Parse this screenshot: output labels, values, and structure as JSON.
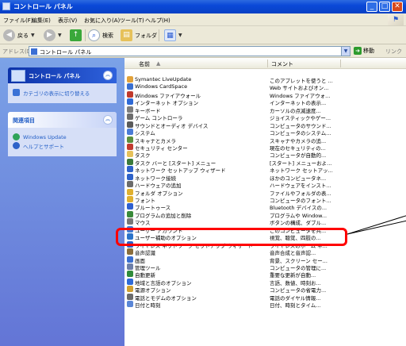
{
  "window": {
    "title": "コントロール パネル"
  },
  "menu": [
    "ファイル(F)",
    "編集(E)",
    "表示(V)",
    "お気に入り(A)",
    "ツール(T)",
    "ヘルプ(H)"
  ],
  "toolbar": {
    "back": "戻る",
    "search": "検索",
    "folders": "フォルダ"
  },
  "address": {
    "label": "アドレス(D)",
    "value": "コントロール パネル",
    "go": "移動",
    "links": "リンク"
  },
  "sidebar": {
    "panel_title": "コントロール パネル",
    "switch_view": "カテゴリの表示に切り替える",
    "related_title": "関連項目",
    "related_links": [
      "Windows Update",
      "ヘルプとサポート"
    ]
  },
  "columns": {
    "name": "名前",
    "comment": "コメント"
  },
  "items": [
    {
      "name": "Symantec LiveUpdate",
      "comment": "このアプレットを使うと ...",
      "color": "#e2a23a"
    },
    {
      "name": "Windows CardSpace",
      "comment": "Web サイトおよびオン...",
      "color": "#3a6fd0"
    },
    {
      "name": "Windows ファイアウォール",
      "comment": "Windows ファイアウォ...",
      "color": "#c0392b"
    },
    {
      "name": "インターネット オプション",
      "comment": "インターネットの表示...",
      "color": "#2f6ad6"
    },
    {
      "name": "キーボード",
      "comment": "カーソルの点滅速度...",
      "color": "#7d7d7d"
    },
    {
      "name": "ゲーム コントローラ",
      "comment": "ジョイスティックやゲー...",
      "color": "#6d6d6d"
    },
    {
      "name": "サウンドとオーディオ デバイス",
      "comment": "コンピュータのサウンド...",
      "color": "#5a5a5a"
    },
    {
      "name": "システム",
      "comment": "コンピュータのシステム...",
      "color": "#4a7bd6"
    },
    {
      "name": "スキャナとカメラ",
      "comment": "スキャナやカメラの追...",
      "color": "#5b8f3c"
    },
    {
      "name": "セキュリティ センター",
      "comment": "現在のセキュリティの...",
      "color": "#c23b2f"
    },
    {
      "name": "タスク",
      "comment": "コンピュータが自動的...",
      "color": "#e6c15a"
    },
    {
      "name": "タスク バーと [スタート] メニュー",
      "comment": "[スタート] メニューおよ...",
      "color": "#3b7a3b"
    },
    {
      "name": "ネットワーク セットアップ ウィザード",
      "comment": "ネットワーク セットアッ...",
      "color": "#2e62c9"
    },
    {
      "name": "ネットワーク接続",
      "comment": "ほかのコンピュータネ...",
      "color": "#2e62c9"
    },
    {
      "name": "ハードウェアの追加",
      "comment": "ハードウェアをインスト...",
      "color": "#6b6b6b"
    },
    {
      "name": "フォルダ オプション",
      "comment": "ファイルやフォルダの表...",
      "color": "#e0b030"
    },
    {
      "name": "フォント",
      "comment": "コンピュータのフォント...",
      "color": "#e0b030"
    },
    {
      "name": "ブルートゥース",
      "comment": "Bluetooth デバイスの...",
      "color": "#2f5fcf"
    },
    {
      "name": "プログラムの追加と削除",
      "comment": "プログラムや Window...",
      "color": "#3a8a3a"
    },
    {
      "name": "マウス",
      "comment": "ボタンの構成、ダブル...",
      "color": "#777777"
    },
    {
      "name": "ユーザー アカウント",
      "comment": "このコンピュータを共...",
      "color": "#3f7bd6"
    },
    {
      "name": "ユーザー補助のオプション",
      "comment": "視覚、聴覚、四肢の...",
      "color": "#2b73c9"
    },
    {
      "name": "ワイヤレス ネットワーク セットアップ ウィザード",
      "comment": "ワイヤレスのホーム ネ...",
      "color": "#2e62c9"
    },
    {
      "name": "音声認識",
      "comment": "音声合成と音声認...",
      "color": "#8a6d3b"
    },
    {
      "name": "画面",
      "comment": "背景、スクリーン セー...",
      "color": "#3a6fd0"
    },
    {
      "name": "管理ツール",
      "comment": "コンピュータの管理に...",
      "color": "#6d7fa8"
    },
    {
      "name": "自動更新",
      "comment": "重要な更新が自動...",
      "color": "#2f8b3a"
    },
    {
      "name": "地域と言語のオプション",
      "comment": "言語、数値、時刻お...",
      "color": "#2f6ad6"
    },
    {
      "name": "電源オプション",
      "comment": "コンピュータの省電力...",
      "color": "#d0a030"
    },
    {
      "name": "電話とモデムのオプション",
      "comment": "電話のダイヤル情報...",
      "color": "#6b6b6b"
    },
    {
      "name": "日付と時刻",
      "comment": "日付、時刻とタイム...",
      "color": "#5a86d6"
    }
  ],
  "highlighted_item": "プログラムの追加と削除"
}
